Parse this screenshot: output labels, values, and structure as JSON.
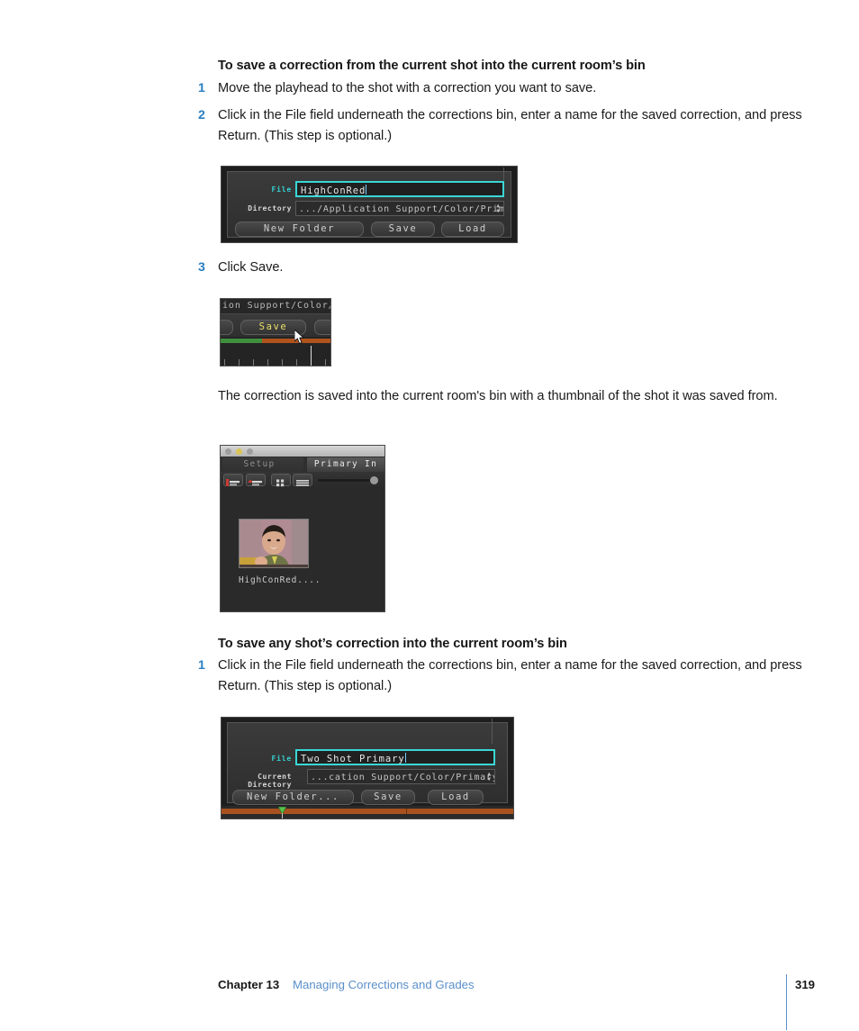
{
  "page": {
    "footer": {
      "chapter": "Chapter 13",
      "title": "Managing Corrections and Grades",
      "page_number": "319"
    }
  },
  "section1": {
    "heading": "To save a correction from the current shot into the current room’s bin",
    "steps": [
      {
        "num": "1",
        "text": "Move the playhead to the shot with a correction you want to save."
      },
      {
        "num": "2",
        "text": "Click in the File field underneath the corrections bin, enter a name for the saved correction, and press Return. (This step is optional.)"
      },
      {
        "num": "3",
        "text": "Click Save."
      }
    ],
    "body_paragraph": "The correction is saved into the current room's bin with a thumbnail of the shot it was saved from."
  },
  "section2": {
    "heading": "To save any shot’s correction into the current room’s bin",
    "steps": [
      {
        "num": "1",
        "text": "Click in the File field underneath the corrections bin, enter a name for the saved correction, and press Return. (This step is optional.)"
      }
    ]
  },
  "figure1": {
    "file_label": "File",
    "file_value": "HighConRed",
    "directory_label": "Directory",
    "directory_value": ".../Application Support/Color/Primary/",
    "buttons": {
      "new_folder": "New Folder",
      "save": "Save",
      "load": "Load"
    }
  },
  "figure2": {
    "path_fragment": "ion Support/Color/",
    "save_label": "Save",
    "cursor": "arrow-cursor"
  },
  "figure3": {
    "tab_inactive": "Setup",
    "tab_active": "Primary In",
    "thumbnail_label": "HighConRed....",
    "toolbar_icons": [
      "add-correction-icon",
      "add-grade-icon",
      "grid-view-icon",
      "list-view-icon",
      "zoom-slider"
    ]
  },
  "figure4": {
    "file_label": "File",
    "file_value": "Two Shot Primary",
    "directory_label": "Current Directory",
    "directory_value": "...cation Support/Color/Primary/",
    "buttons": {
      "new_folder": "New Folder...",
      "save": "Save",
      "load": "Load"
    }
  },
  "colors": {
    "step_number": "#2a7fc1",
    "footer_link": "#5b8fc9",
    "field_focus_border": "#3ad6d6",
    "file_label": "#35d2d2",
    "button_highlight": "#e8e06a",
    "timeline_orange": "#b0531d",
    "timeline_green": "#3f8f3f"
  }
}
